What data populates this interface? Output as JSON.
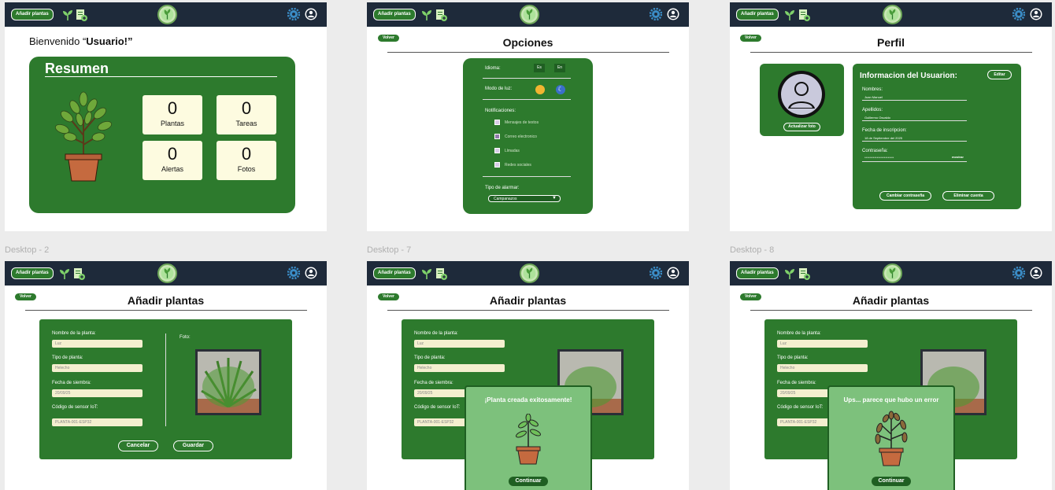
{
  "nav": {
    "add_label": "Añadir plantas"
  },
  "frame_labels": [
    "Desktop - 2",
    "Desktop - 7",
    "Desktop - 8"
  ],
  "back_label": "Volver",
  "home": {
    "welcome_prefix": "Bienvenido “",
    "welcome_user": "Usuario!",
    "welcome_suffix": "”",
    "summary_title": "Resumen",
    "stats": [
      {
        "value": "0",
        "label": "Plantas"
      },
      {
        "value": "0",
        "label": "Tareas"
      },
      {
        "value": "0",
        "label": "Alertas"
      },
      {
        "value": "0",
        "label": "Fotos"
      }
    ]
  },
  "options": {
    "title": "Opciones",
    "language_label": "Idioma:",
    "lang_es": "Es",
    "lang_en": "En",
    "light_mode_label": "Modo de luz:",
    "notifications_label": "Notificaciones:",
    "notifications": [
      "Mensajes de textos",
      "Correo electronico",
      "Llmadas",
      "Redes sociales"
    ],
    "alarm_label": "Tipo de alarmar:",
    "alarm_value": "Campanazos"
  },
  "profile": {
    "title": "Perfil",
    "update_photo": "Actualizar foto",
    "info_title": "Informacion del Usuarion:",
    "edit": "Editar",
    "name_label": "Nombres:",
    "name_value": "Juan Manuel",
    "surname_label": "Apellidos:",
    "surname_value": "Guillermo Osvaldo",
    "date_label": "Fecha de inscripcion:",
    "date_value": "18 de Septiembre del 2025",
    "password_label": "Contraseña:",
    "password_value": "************************",
    "show": "mostrar",
    "change_password": "Cambiar contraseña",
    "delete_account": "Eliminar cuenta"
  },
  "add": {
    "title": "Añadir plantas",
    "name_label": "Nombre de la planta:",
    "name_value": "Luz",
    "type_label": "Tipo de planta:",
    "type_value": "Helecho",
    "date_label": "Fecha de siembra:",
    "date_value": "20/09/25",
    "sensor_label": "Código de sensor IoT:",
    "sensor_value": "PLANTA-001-ESP32",
    "photo_label": "Foto:",
    "cancel": "Cancelar",
    "save": "Guardar"
  },
  "success": {
    "message": "¡Planta creada exitosamente!",
    "continue": "Continuar"
  },
  "error": {
    "message": "Ups... parece que hubo un error",
    "continue": "Continuar"
  },
  "colors": {
    "nav": "#1e2a3a",
    "green": "#2d7a2d",
    "card": "#fdfbe0",
    "modal": "#7dc17c"
  }
}
